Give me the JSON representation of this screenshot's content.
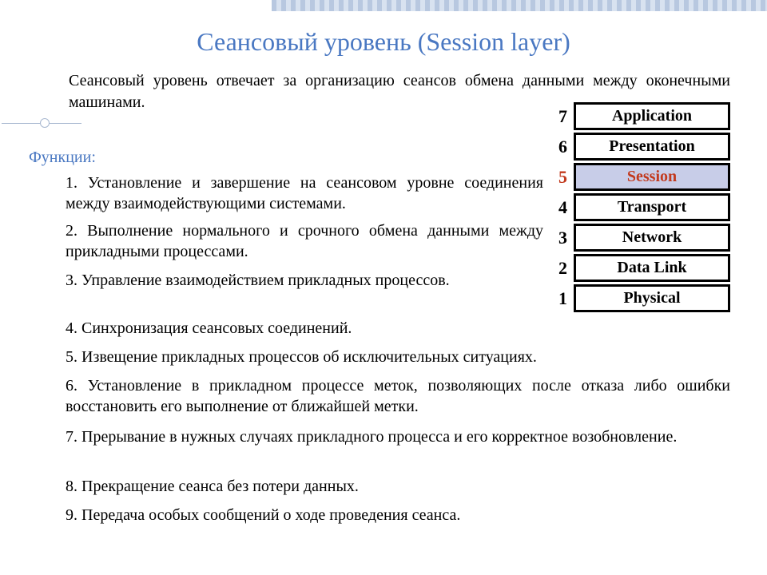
{
  "title": "Сеансовый уровень (Session layer)",
  "intro": "Сеансовый уровень отвечает за организацию сеансов обмена данными между оконечными машинами.",
  "functions_label": "Функции:",
  "functions": {
    "f1": "1. Установление и завершение на сеансовом уровне соединения между взаимодействующими системами.",
    "f2": "2. Выполнение нормального и срочного обмена данными между прикладными процессами.",
    "f3": "3. Управление взаимодействием прикладных процессов.",
    "f4": "4.  Синхронизация сеансовых соединений.",
    "f5": "5.  Извещение прикладных процессов об исключительных ситуациях.",
    "f6": "6. Установление в прикладном процессе меток, позволяющих после отказа либо ошибки восстановить его выполнение от ближайшей метки.",
    "f7": "7. Прерывание в нужных случаях прикладного процесса и его корректное возобновление.",
    "f8": "8.  Прекращение сеанса без потери данных.",
    "f9": "9. Передача особых сообщений о ходе проведения сеанса."
  },
  "layers": [
    {
      "num": "7",
      "name": "Application",
      "highlight": false
    },
    {
      "num": "6",
      "name": "Presentation",
      "highlight": false
    },
    {
      "num": "5",
      "name": "Session",
      "highlight": true
    },
    {
      "num": "4",
      "name": "Transport",
      "highlight": false
    },
    {
      "num": "3",
      "name": "Network",
      "highlight": false
    },
    {
      "num": "2",
      "name": "Data Link",
      "highlight": false
    },
    {
      "num": "1",
      "name": "Physical",
      "highlight": false
    }
  ]
}
